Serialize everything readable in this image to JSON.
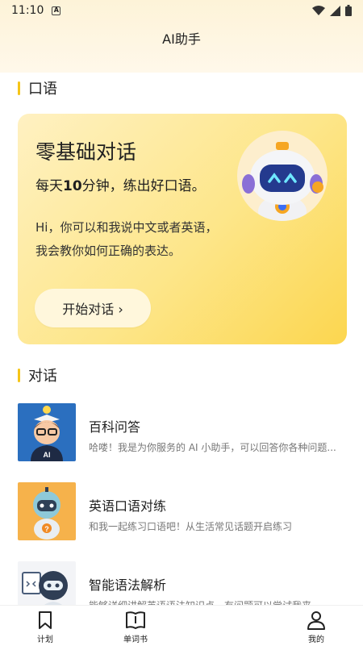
{
  "status": {
    "time": "11:10",
    "badge": "A"
  },
  "header": {
    "title": "AI助手"
  },
  "oral_section": {
    "title": "口语"
  },
  "hero": {
    "title": "零基础对话",
    "sub_prefix": "每天",
    "sub_bold": "10",
    "sub_suffix": "分钟，练出好口语。",
    "desc": "Hi，你可以和我说中文或者英语，我会教你如何正确的表达。",
    "button": "开始对话 ›"
  },
  "dialog_section": {
    "title": "对话"
  },
  "list": [
    {
      "title": "百科问答",
      "desc": "哈喽！我是为你服务的 AI 小助手，可以回答你各种问题...",
      "badge": "AI"
    },
    {
      "title": "英语口语对练",
      "desc": "和我一起练习口语吧！从生活常见话题开启练习",
      "badge": "?"
    },
    {
      "title": "智能语法解析",
      "desc": "能够详细讲解英语语法知识点，有问题可以尝试我来..."
    }
  ],
  "nav": [
    {
      "label": "计划"
    },
    {
      "label": "单词书"
    },
    {
      "label": "我的"
    }
  ],
  "colors": {
    "accent": "#f5c518",
    "hero_bg": "#fde68a"
  }
}
